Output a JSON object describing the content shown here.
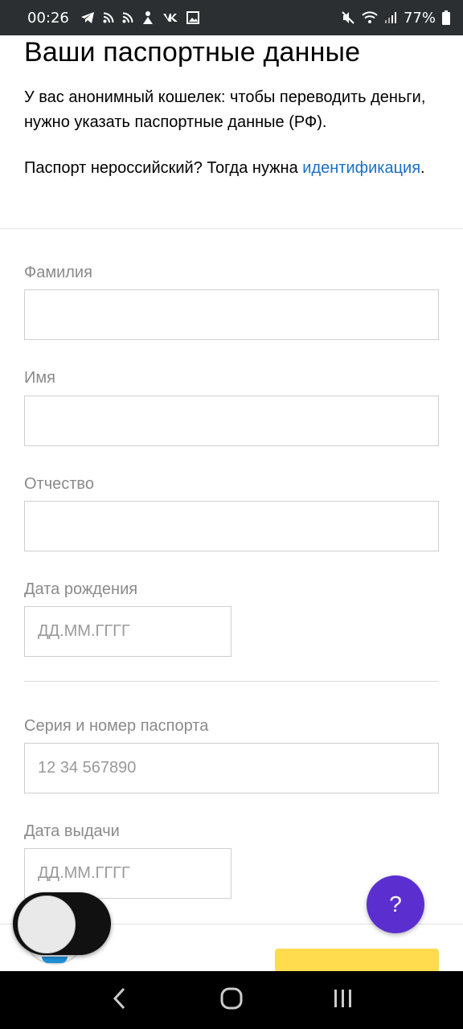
{
  "status_bar": {
    "time": "00:26",
    "battery": "77%",
    "left_icons": [
      "telegram-icon",
      "rss-icon",
      "rss-icon",
      "app-icon",
      "vk-icon",
      "image-icon"
    ],
    "right_icons": [
      "mute-icon",
      "wifi-icon",
      "signal-icon",
      "battery-icon"
    ]
  },
  "header": {
    "title": "Ваши паспортные данные",
    "intro": "У вас анонимный кошелек: чтобы переводить деньги, нужно указать паспортные данные (РФ).",
    "foreign_prefix": "Паспорт нероссийский? Тогда нужна ",
    "foreign_link": "идентификация",
    "foreign_suffix": "."
  },
  "form": {
    "surname": {
      "label": "Фамилия",
      "value": "",
      "placeholder": ""
    },
    "name": {
      "label": "Имя",
      "value": "",
      "placeholder": ""
    },
    "patronymic": {
      "label": "Отчество",
      "value": "",
      "placeholder": ""
    },
    "birth_date": {
      "label": "Дата рождения",
      "value": "",
      "placeholder": "ДД.ММ.ГГГГ"
    },
    "passport_number": {
      "label": "Серия и номер паспорта",
      "value": "",
      "placeholder": "12 34 567890"
    },
    "issue_date": {
      "label": "Дата выдачи",
      "value": "",
      "placeholder": "ДД.ММ.ГГГГ"
    }
  },
  "help_button": {
    "label": "?"
  },
  "colors": {
    "status_bar": "#2c2f32",
    "link": "#1a6fc6",
    "help_fab": "#5b2fcf",
    "submit": "#ffdc4d",
    "label": "#8a8a8a"
  }
}
